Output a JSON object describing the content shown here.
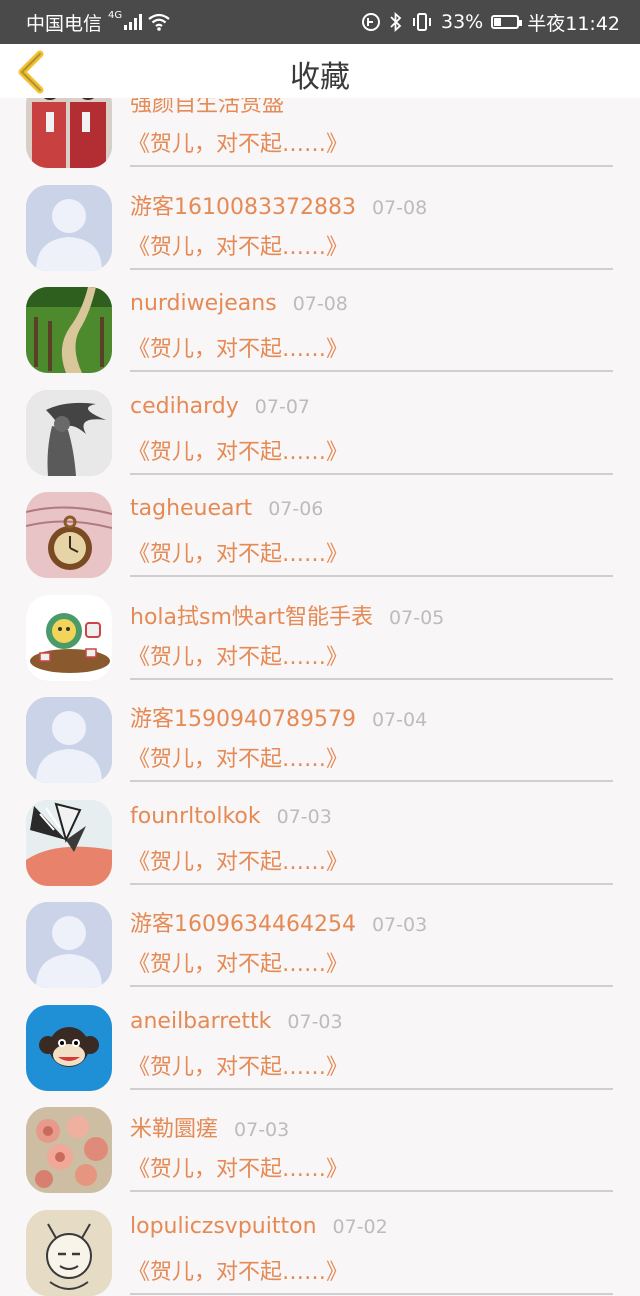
{
  "status_bar": {
    "carrier": "中国电信",
    "network": "4G",
    "battery": "33%",
    "battery_level": 0.33,
    "time": "半夜11:42"
  },
  "header": {
    "title": "收藏",
    "back_icon": "chevron-left-icon"
  },
  "colors": {
    "accent": "#e58a55",
    "date": "#bcbcbc",
    "back_icon": "#f2c12e"
  },
  "items": [
    {
      "name": "强颜自生活赏盛",
      "date": "",
      "message": "《贺儿，对不起……》",
      "avatar": "photo-couple"
    },
    {
      "name": "游客1610083372883",
      "date": "07-08",
      "message": "《贺儿，对不起……》",
      "avatar": "default-person"
    },
    {
      "name": "nurdiwejeans",
      "date": "07-08",
      "message": "《贺儿，对不起……》",
      "avatar": "photo-garden-path"
    },
    {
      "name": "cedihardy",
      "date": "07-07",
      "message": "《贺儿，对不起……》",
      "avatar": "photo-girl-hair"
    },
    {
      "name": "tagheueart",
      "date": "07-06",
      "message": "《贺儿，对不起……》",
      "avatar": "photo-pocket-watch"
    },
    {
      "name": "hola拭sm怏art智能手表",
      "date": "07-05",
      "message": "《贺儿，对不起……》",
      "avatar": "cartoon-cat-tea"
    },
    {
      "name": "游客1590940789579",
      "date": "07-04",
      "message": "《贺儿，对不起……》",
      "avatar": "default-person"
    },
    {
      "name": "founrltolkok",
      "date": "07-03",
      "message": "《贺儿，对不起……》",
      "avatar": "photo-butterfly"
    },
    {
      "name": "游客1609634464254",
      "date": "07-03",
      "message": "《贺儿，对不起……》",
      "avatar": "default-person"
    },
    {
      "name": "aneilbarrettk",
      "date": "07-03",
      "message": "《贺儿，对不起……》",
      "avatar": "cartoon-monkey"
    },
    {
      "name": "米勒圜瘥",
      "date": "07-03",
      "message": "《贺儿，对不起……》",
      "avatar": "photo-roses"
    },
    {
      "name": "lopuliczsvpuitton",
      "date": "07-02",
      "message": "《贺儿，对不起……》",
      "avatar": "cartoon-sketch"
    }
  ]
}
